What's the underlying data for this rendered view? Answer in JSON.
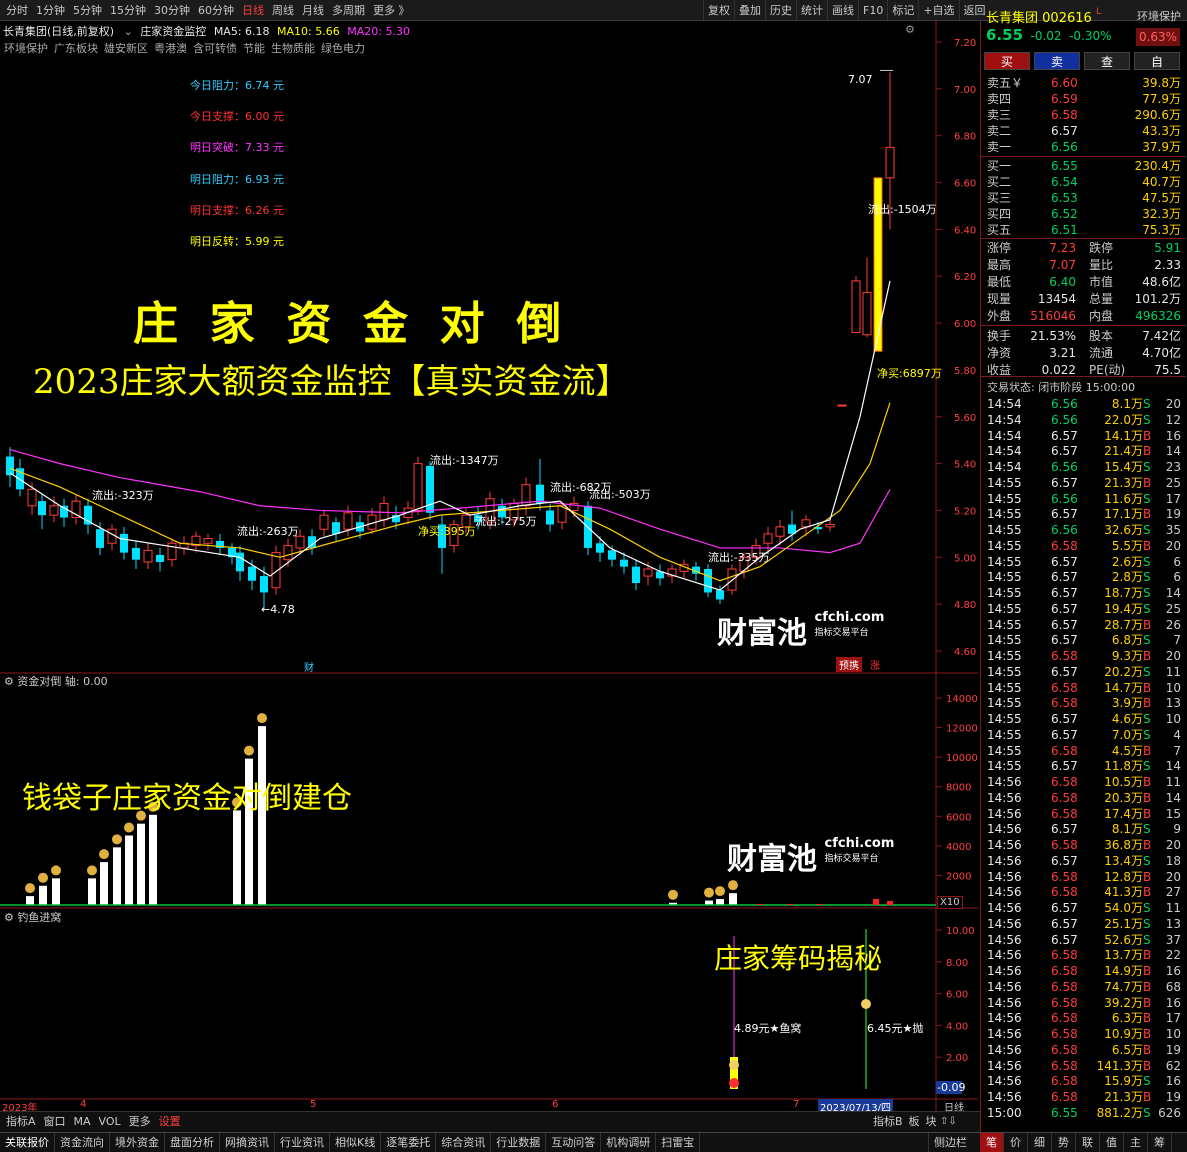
{
  "periods": [
    "分时",
    "1分钟",
    "5分钟",
    "15分钟",
    "30分钟",
    "60分钟",
    "日线",
    "周线",
    "月线",
    "多周期",
    "更多 》"
  ],
  "active_period": "日线",
  "toolbar": [
    "复权",
    "叠加",
    "历史",
    "统计",
    "画线",
    "F10",
    "标记",
    "+自选",
    "返回"
  ],
  "chart": {
    "title": "长青集团(日线,前复权)",
    "indicator_name": "庄家资金监控",
    "ma5": "MA5: 6.18",
    "ma10": "MA10: 5.66",
    "ma20": "MA20: 5.30",
    "tags": [
      "环境保护",
      "广东板块",
      "雄安新区",
      "粤港澳",
      "含可转债",
      "节能",
      "生物质能",
      "绿色电力"
    ],
    "levels": [
      {
        "label": "今日阻力：6.74 元",
        "color": "#33ccff"
      },
      {
        "label": "今日支撑：6.00 元",
        "color": "#ff3333"
      },
      {
        "label": "明日突破：7.33 元",
        "color": "#ff33ff"
      },
      {
        "label": "明日阻力：6.93 元",
        "color": "#33ccff"
      },
      {
        "label": "明日支撑：6.26 元",
        "color": "#ff3333"
      },
      {
        "label": "明日反转：5.99 元",
        "color": "#ffff00"
      }
    ],
    "headline1": "庄 家 资 金 对 倒",
    "headline2": "2023庄家大额资金监控【真实资金流】",
    "high_label": "7.07",
    "low_label": "4.78",
    "y_ticks": [
      "7.20",
      "7.00",
      "6.80",
      "6.60",
      "6.40",
      "6.20",
      "6.00",
      "5.80",
      "5.60",
      "5.40",
      "5.20",
      "5.00",
      "4.80",
      "4.60"
    ],
    "flow_labels": [
      "流出:-323万",
      "流出:-263万",
      "流出:-1347万",
      "净买:395万",
      "流出:-275万",
      "流出:-682万",
      "流出:-503万",
      "流出:-335万",
      "流出:-1504万",
      "净买:6897万"
    ],
    "badges": [
      "财",
      "预携",
      "涨"
    ]
  },
  "panel2": {
    "title": "资金对倒 轴: 0.00",
    "caption": "钱袋子庄家资金对倒建仓",
    "y_ticks": [
      "14000",
      "12000",
      "10000",
      "8000",
      "6000",
      "4000",
      "2000"
    ],
    "x10": "X10"
  },
  "panel3": {
    "title": "钓鱼进窝",
    "caption": "庄家筹码揭秘",
    "label1": "4.89元★鱼窝",
    "label2": "6.45元★抛",
    "y_ticks": [
      "10.00",
      "8.00",
      "6.00",
      "4.00",
      "2.00"
    ],
    "value": "-0.09"
  },
  "watermark": {
    "brand": "财富池",
    "url": "cfchi.com",
    "sub": "指标交易平台"
  },
  "xaxis": {
    "labels": [
      "2023年",
      "4",
      "5",
      "6",
      "7"
    ],
    "date": "2023/07/13/四",
    "period": "日线"
  },
  "subtabs": [
    "指标A",
    "窗口",
    "MA",
    "VOL",
    "更多",
    "设置"
  ],
  "subtabs_right": [
    "指标B",
    "板",
    "块"
  ],
  "bottom_tabs": [
    "关联报价",
    "资金流向",
    "境外资金",
    "盘面分析",
    "网摘资讯",
    "行业资讯",
    "相似K线",
    "逐笔委托",
    "综合资讯",
    "行业数据",
    "互动问答",
    "机构调研",
    "扫雷宝"
  ],
  "bottom_right": "侧边栏",
  "bottom_right_tabs": [
    "笔",
    "价",
    "细",
    "势",
    "联",
    "值",
    "主",
    "筹"
  ],
  "stock": {
    "name": "长青集团",
    "code": "002616",
    "flag": "L",
    "sector": "环境保护",
    "sector_pct": "0.63%",
    "price": "6.55",
    "change": "-0.02",
    "pct": "-0.30%",
    "actions": [
      "买",
      "卖",
      "查",
      "自"
    ]
  },
  "orderbook": {
    "sell": [
      [
        "卖五￥",
        "6.60",
        "39.8万"
      ],
      [
        "卖四",
        "6.59",
        "77.9万"
      ],
      [
        "卖三",
        "6.58",
        "290.6万"
      ],
      [
        "卖二",
        "6.57",
        "43.3万"
      ],
      [
        "卖一",
        "6.56",
        "37.9万"
      ]
    ],
    "buy": [
      [
        "买一",
        "6.55",
        "230.4万"
      ],
      [
        "买二",
        "6.54",
        "40.7万"
      ],
      [
        "买三",
        "6.53",
        "47.5万"
      ],
      [
        "买四",
        "6.52",
        "32.3万"
      ],
      [
        "买五",
        "6.51",
        "75.3万"
      ]
    ]
  },
  "stats": [
    [
      "涨停",
      "7.23",
      "跌停",
      "5.91"
    ],
    [
      "最高",
      "7.07",
      "量比",
      "2.33"
    ],
    [
      "最低",
      "6.40",
      "市值",
      "48.6亿"
    ],
    [
      "现量",
      "13454",
      "总量",
      "101.2万"
    ],
    [
      "外盘",
      "516046",
      "内盘",
      "496326"
    ],
    [
      "换手",
      "21.53%",
      "股本",
      "7.42亿"
    ],
    [
      "净资",
      "3.21",
      "流通",
      "4.70亿"
    ],
    [
      "收益",
      "0.022",
      "PE(动)",
      "75.5"
    ]
  ],
  "trade_status": "交易状态: 闭市阶段 15:00:00",
  "ticks": [
    [
      "14:54",
      "6.56",
      "8.1万",
      "S",
      "20"
    ],
    [
      "14:54",
      "6.56",
      "22.0万",
      "S",
      "12"
    ],
    [
      "14:54",
      "6.57",
      "14.1万",
      "B",
      "16"
    ],
    [
      "14:54",
      "6.57",
      "21.4万",
      "B",
      "14"
    ],
    [
      "14:54",
      "6.56",
      "15.4万",
      "S",
      "23"
    ],
    [
      "14:55",
      "6.57",
      "21.3万",
      "B",
      "25"
    ],
    [
      "14:55",
      "6.56",
      "11.6万",
      "S",
      "17"
    ],
    [
      "14:55",
      "6.57",
      "17.1万",
      "B",
      "19"
    ],
    [
      "14:55",
      "6.56",
      "32.6万",
      "S",
      "35"
    ],
    [
      "14:55",
      "6.58",
      "5.5万",
      "B",
      "20"
    ],
    [
      "14:55",
      "6.57",
      "2.6万",
      "S",
      "6"
    ],
    [
      "14:55",
      "6.57",
      "2.8万",
      "S",
      "6"
    ],
    [
      "14:55",
      "6.57",
      "18.7万",
      "S",
      "14"
    ],
    [
      "14:55",
      "6.57",
      "19.4万",
      "S",
      "25"
    ],
    [
      "14:55",
      "6.57",
      "28.7万",
      "B",
      "26"
    ],
    [
      "14:55",
      "6.57",
      "6.8万",
      "S",
      "7"
    ],
    [
      "14:55",
      "6.58",
      "9.3万",
      "B",
      "20"
    ],
    [
      "14:55",
      "6.57",
      "20.2万",
      "S",
      "11"
    ],
    [
      "14:55",
      "6.58",
      "14.7万",
      "B",
      "10"
    ],
    [
      "14:55",
      "6.58",
      "3.9万",
      "B",
      "13"
    ],
    [
      "14:55",
      "6.57",
      "4.6万",
      "S",
      "10"
    ],
    [
      "14:55",
      "6.57",
      "7.0万",
      "S",
      "4"
    ],
    [
      "14:55",
      "6.58",
      "4.5万",
      "B",
      "7"
    ],
    [
      "14:55",
      "6.57",
      "11.8万",
      "S",
      "14"
    ],
    [
      "14:56",
      "6.58",
      "10.5万",
      "B",
      "11"
    ],
    [
      "14:56",
      "6.58",
      "20.3万",
      "B",
      "14"
    ],
    [
      "14:56",
      "6.58",
      "17.4万",
      "B",
      "15"
    ],
    [
      "14:56",
      "6.57",
      "8.1万",
      "S",
      "9"
    ],
    [
      "14:56",
      "6.58",
      "36.8万",
      "B",
      "20"
    ],
    [
      "14:56",
      "6.57",
      "13.4万",
      "S",
      "18"
    ],
    [
      "14:56",
      "6.58",
      "12.8万",
      "B",
      "20"
    ],
    [
      "14:56",
      "6.58",
      "41.3万",
      "B",
      "27"
    ],
    [
      "14:56",
      "6.57",
      "54.0万",
      "S",
      "11"
    ],
    [
      "14:56",
      "6.57",
      "25.1万",
      "S",
      "13"
    ],
    [
      "14:56",
      "6.57",
      "52.6万",
      "S",
      "37"
    ],
    [
      "14:56",
      "6.58",
      "13.7万",
      "B",
      "22"
    ],
    [
      "14:56",
      "6.58",
      "14.9万",
      "B",
      "16"
    ],
    [
      "14:56",
      "6.58",
      "74.7万",
      "B",
      "68"
    ],
    [
      "14:56",
      "6.58",
      "39.2万",
      "B",
      "16"
    ],
    [
      "14:56",
      "6.58",
      "6.3万",
      "B",
      "17"
    ],
    [
      "14:56",
      "6.58",
      "10.9万",
      "B",
      "10"
    ],
    [
      "14:56",
      "6.58",
      "6.5万",
      "B",
      "19"
    ],
    [
      "14:56",
      "6.58",
      "141.3万",
      "B",
      "62"
    ],
    [
      "14:56",
      "6.58",
      "15.9万",
      "S",
      "16"
    ],
    [
      "14:56",
      "6.58",
      "21.3万",
      "B",
      "19"
    ],
    [
      "15:00",
      "6.55",
      "881.2万",
      "S",
      "626"
    ]
  ]
}
